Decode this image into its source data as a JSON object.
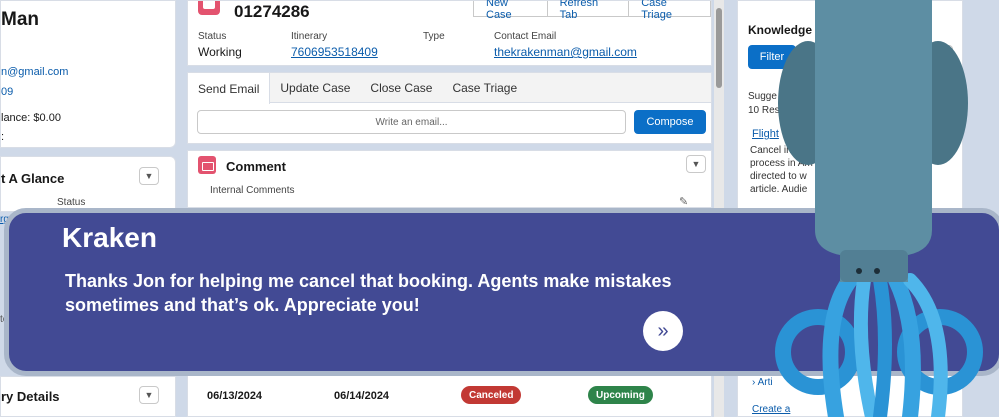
{
  "left": {
    "name": "Man",
    "email": "n@gmail.com",
    "phone": "09",
    "balance": "lance: $0.00",
    "colon": ":",
    "glance_title": "t A Glance",
    "status_label": "Status",
    "cut_link": "rg",
    "cut_text": "te",
    "details_title": "ry Details"
  },
  "case": {
    "number": "01274286",
    "buttons": [
      "New Case",
      "Refresh Tab",
      "Case Triage"
    ],
    "fields": {
      "status_label": "Status",
      "status_value": "Working",
      "itinerary_label": "Itinerary",
      "itinerary_value": "7606953518409",
      "type_label": "Type",
      "contact_label": "Contact Email",
      "contact_value": "thekrakenman@gmail.com"
    }
  },
  "tabs": [
    "Send Email",
    "Update Case",
    "Close Case",
    "Case Triage"
  ],
  "email": {
    "placeholder": "Write an email...",
    "compose": "Compose"
  },
  "comment": {
    "title": "Comment",
    "internal": "Internal Comments"
  },
  "bookings": {
    "dates": [
      "06/13/2024",
      "06/14/2024"
    ],
    "status_1": "Canceled",
    "status_2": "Upcoming",
    "colors": {
      "canceled": "#c23934",
      "upcoming": "#2e844a"
    }
  },
  "knowledge": {
    "title": "Knowledge",
    "filter": "Filter",
    "suggested": "Sugge",
    "results": "10 Resu",
    "link": "Flight",
    "body": [
      "Cancel in Am",
      "process in Am",
      "directed to w",
      "article. Audie"
    ],
    "article": "Arti",
    "create": "Create a"
  },
  "banner": {
    "title": "Kraken",
    "message": "Thanks Jon  for helping me cancel that booking. Agents make mistakes sometimes and that’s ok. Appreciate you!",
    "next_glyph": "»"
  }
}
